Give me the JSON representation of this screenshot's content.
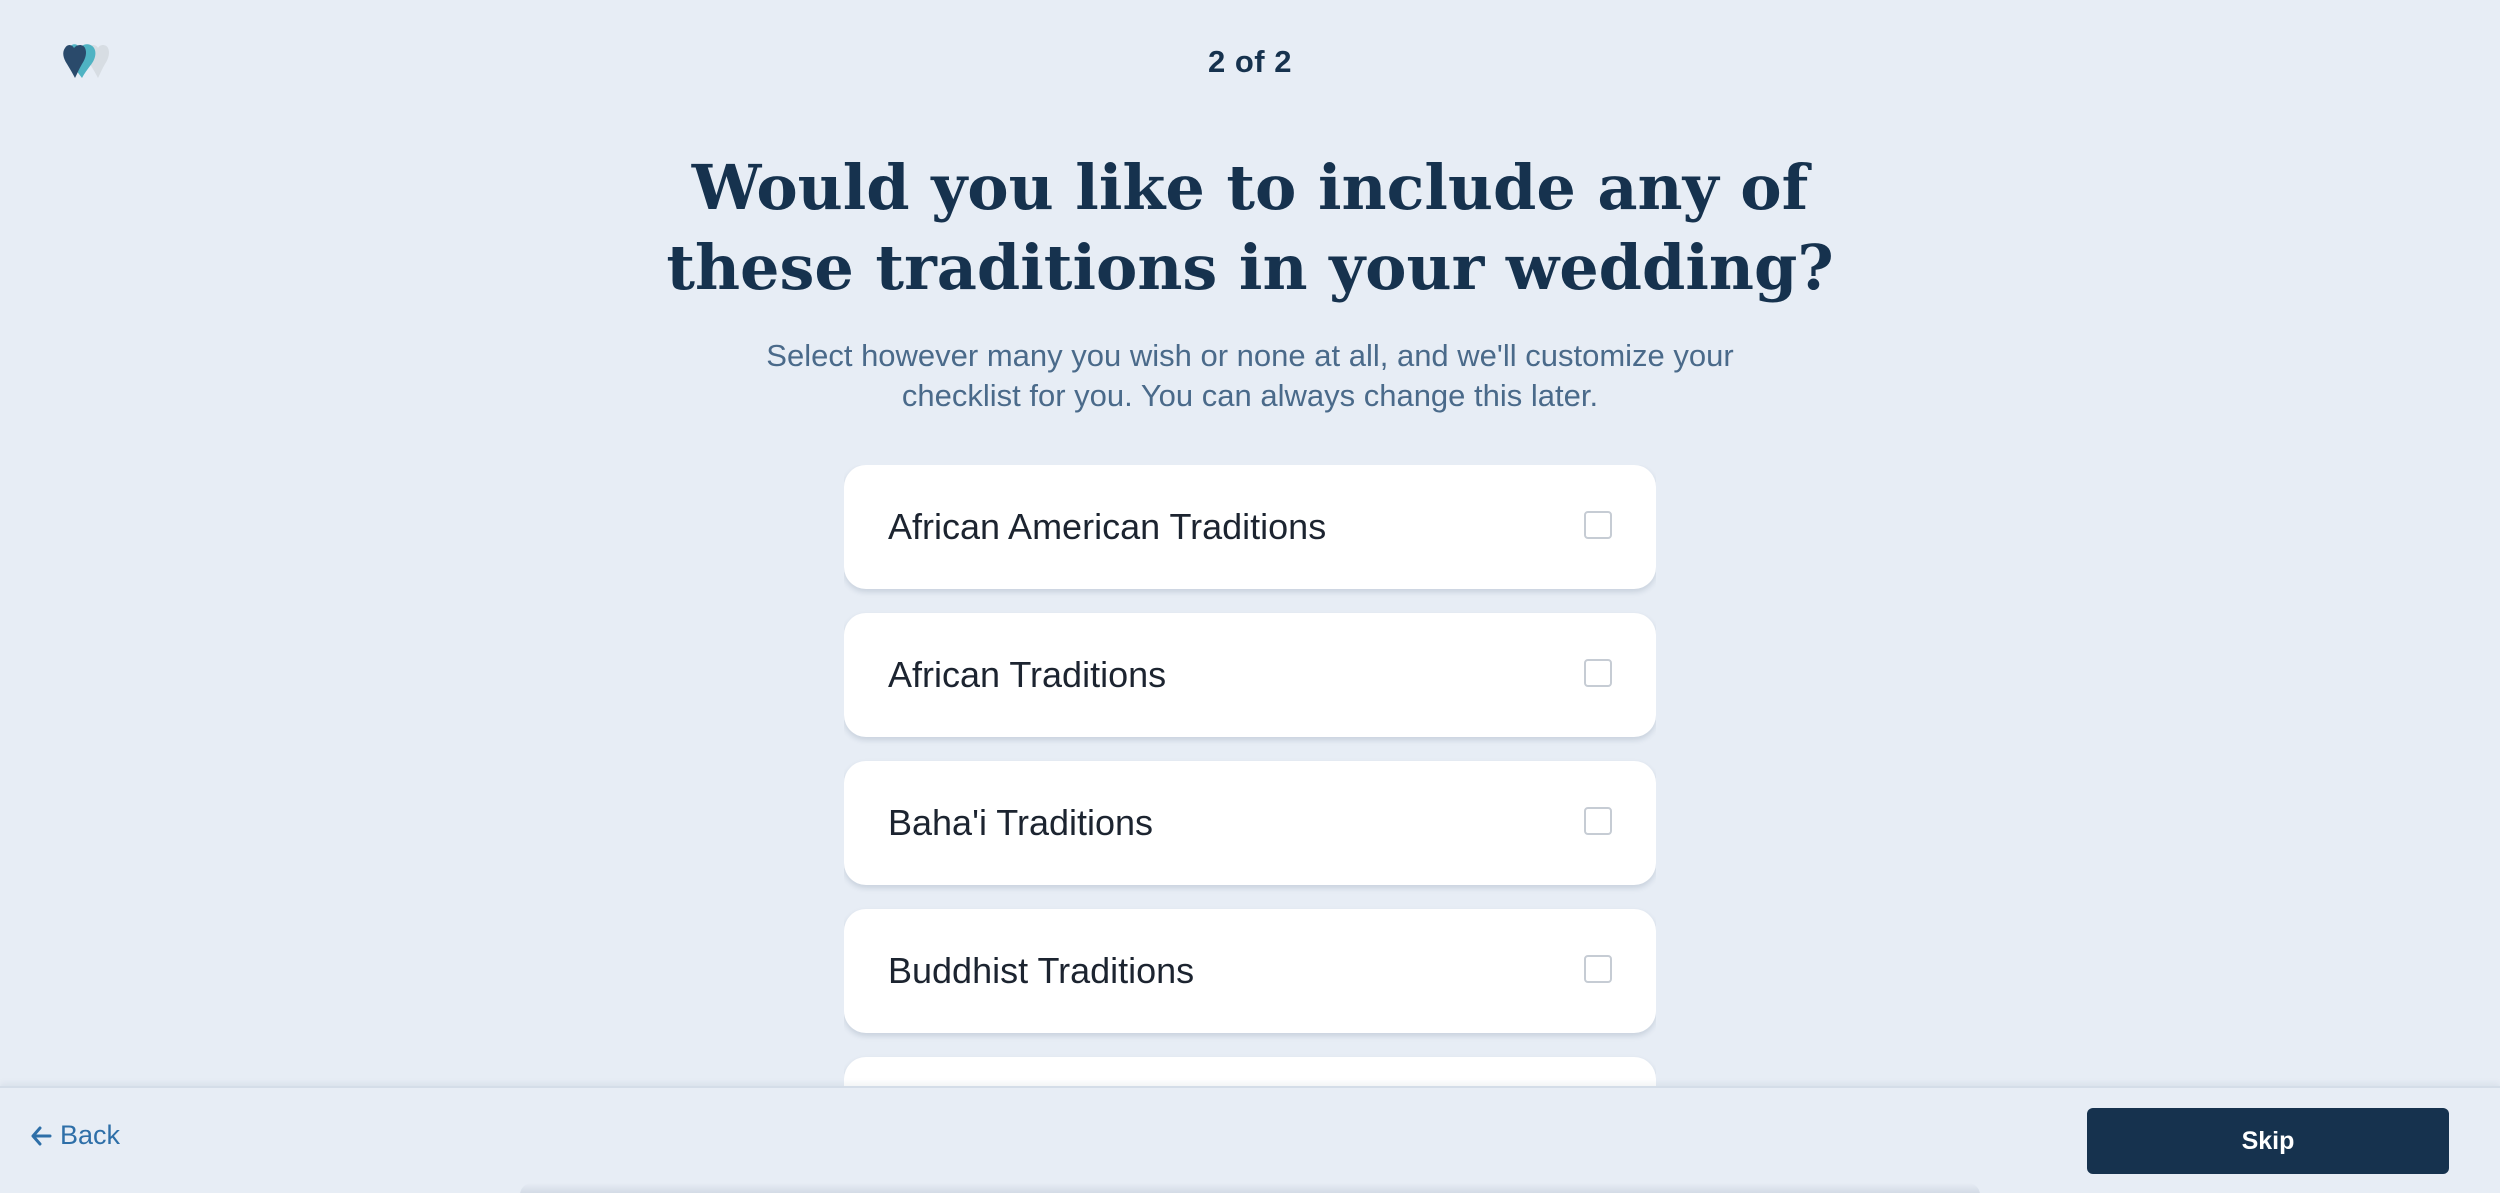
{
  "progress": "2 of 2",
  "headline": "Would you like to include any of these traditions in your wedding?",
  "subtext": "Select however many you wish or none at all, and we'll customize your checklist for you. You can always change this later.",
  "options": [
    {
      "label": "African American Traditions",
      "checked": false
    },
    {
      "label": "African Traditions",
      "checked": false
    },
    {
      "label": "Baha'i Traditions",
      "checked": false
    },
    {
      "label": "Buddhist Traditions",
      "checked": false
    },
    {
      "label": "",
      "checked": false
    }
  ],
  "footer": {
    "back_label": "Back",
    "skip_label": "Skip"
  },
  "icons": {
    "logo": "hearts-logo-icon",
    "back": "arrow-left-icon"
  },
  "colors": {
    "background": "#e7edf5",
    "primary": "#16324e",
    "link": "#2e6fa8",
    "logo_dark": "#2a4a6b",
    "logo_teal": "#4fb3c3",
    "logo_light": "#d7dde3"
  }
}
